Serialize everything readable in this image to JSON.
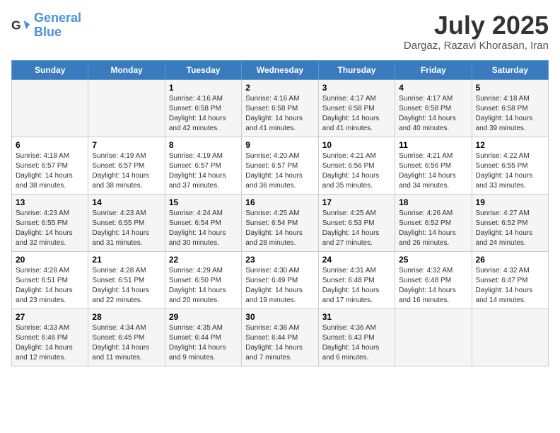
{
  "logo": {
    "line1": "General",
    "line2": "Blue"
  },
  "title": "July 2025",
  "location": "Dargaz, Razavi Khorasan, Iran",
  "weekdays": [
    "Sunday",
    "Monday",
    "Tuesday",
    "Wednesday",
    "Thursday",
    "Friday",
    "Saturday"
  ],
  "weeks": [
    [
      {
        "day": "",
        "content": ""
      },
      {
        "day": "",
        "content": ""
      },
      {
        "day": "1",
        "content": "Sunrise: 4:16 AM\nSunset: 6:58 PM\nDaylight: 14 hours and 42 minutes."
      },
      {
        "day": "2",
        "content": "Sunrise: 4:16 AM\nSunset: 6:58 PM\nDaylight: 14 hours and 41 minutes."
      },
      {
        "day": "3",
        "content": "Sunrise: 4:17 AM\nSunset: 6:58 PM\nDaylight: 14 hours and 41 minutes."
      },
      {
        "day": "4",
        "content": "Sunrise: 4:17 AM\nSunset: 6:58 PM\nDaylight: 14 hours and 40 minutes."
      },
      {
        "day": "5",
        "content": "Sunrise: 4:18 AM\nSunset: 6:58 PM\nDaylight: 14 hours and 39 minutes."
      }
    ],
    [
      {
        "day": "6",
        "content": "Sunrise: 4:18 AM\nSunset: 6:57 PM\nDaylight: 14 hours and 38 minutes."
      },
      {
        "day": "7",
        "content": "Sunrise: 4:19 AM\nSunset: 6:57 PM\nDaylight: 14 hours and 38 minutes."
      },
      {
        "day": "8",
        "content": "Sunrise: 4:19 AM\nSunset: 6:57 PM\nDaylight: 14 hours and 37 minutes."
      },
      {
        "day": "9",
        "content": "Sunrise: 4:20 AM\nSunset: 6:57 PM\nDaylight: 14 hours and 36 minutes."
      },
      {
        "day": "10",
        "content": "Sunrise: 4:21 AM\nSunset: 6:56 PM\nDaylight: 14 hours and 35 minutes."
      },
      {
        "day": "11",
        "content": "Sunrise: 4:21 AM\nSunset: 6:56 PM\nDaylight: 14 hours and 34 minutes."
      },
      {
        "day": "12",
        "content": "Sunrise: 4:22 AM\nSunset: 6:55 PM\nDaylight: 14 hours and 33 minutes."
      }
    ],
    [
      {
        "day": "13",
        "content": "Sunrise: 4:23 AM\nSunset: 6:55 PM\nDaylight: 14 hours and 32 minutes."
      },
      {
        "day": "14",
        "content": "Sunrise: 4:23 AM\nSunset: 6:55 PM\nDaylight: 14 hours and 31 minutes."
      },
      {
        "day": "15",
        "content": "Sunrise: 4:24 AM\nSunset: 6:54 PM\nDaylight: 14 hours and 30 minutes."
      },
      {
        "day": "16",
        "content": "Sunrise: 4:25 AM\nSunset: 6:54 PM\nDaylight: 14 hours and 28 minutes."
      },
      {
        "day": "17",
        "content": "Sunrise: 4:25 AM\nSunset: 6:53 PM\nDaylight: 14 hours and 27 minutes."
      },
      {
        "day": "18",
        "content": "Sunrise: 4:26 AM\nSunset: 6:52 PM\nDaylight: 14 hours and 26 minutes."
      },
      {
        "day": "19",
        "content": "Sunrise: 4:27 AM\nSunset: 6:52 PM\nDaylight: 14 hours and 24 minutes."
      }
    ],
    [
      {
        "day": "20",
        "content": "Sunrise: 4:28 AM\nSunset: 6:51 PM\nDaylight: 14 hours and 23 minutes."
      },
      {
        "day": "21",
        "content": "Sunrise: 4:28 AM\nSunset: 6:51 PM\nDaylight: 14 hours and 22 minutes."
      },
      {
        "day": "22",
        "content": "Sunrise: 4:29 AM\nSunset: 6:50 PM\nDaylight: 14 hours and 20 minutes."
      },
      {
        "day": "23",
        "content": "Sunrise: 4:30 AM\nSunset: 6:49 PM\nDaylight: 14 hours and 19 minutes."
      },
      {
        "day": "24",
        "content": "Sunrise: 4:31 AM\nSunset: 6:48 PM\nDaylight: 14 hours and 17 minutes."
      },
      {
        "day": "25",
        "content": "Sunrise: 4:32 AM\nSunset: 6:48 PM\nDaylight: 14 hours and 16 minutes."
      },
      {
        "day": "26",
        "content": "Sunrise: 4:32 AM\nSunset: 6:47 PM\nDaylight: 14 hours and 14 minutes."
      }
    ],
    [
      {
        "day": "27",
        "content": "Sunrise: 4:33 AM\nSunset: 6:46 PM\nDaylight: 14 hours and 12 minutes."
      },
      {
        "day": "28",
        "content": "Sunrise: 4:34 AM\nSunset: 6:45 PM\nDaylight: 14 hours and 11 minutes."
      },
      {
        "day": "29",
        "content": "Sunrise: 4:35 AM\nSunset: 6:44 PM\nDaylight: 14 hours and 9 minutes."
      },
      {
        "day": "30",
        "content": "Sunrise: 4:36 AM\nSunset: 6:44 PM\nDaylight: 14 hours and 7 minutes."
      },
      {
        "day": "31",
        "content": "Sunrise: 4:36 AM\nSunset: 6:43 PM\nDaylight: 14 hours and 6 minutes."
      },
      {
        "day": "",
        "content": ""
      },
      {
        "day": "",
        "content": ""
      }
    ]
  ]
}
